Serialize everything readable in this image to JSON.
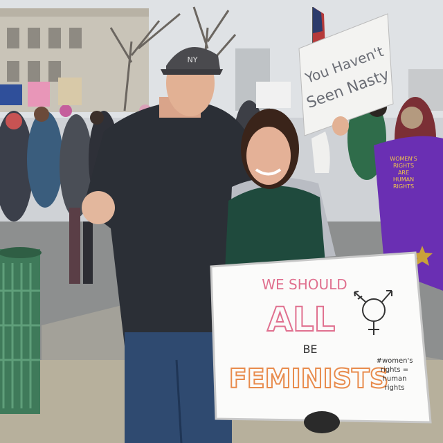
{
  "signs": {
    "top_right": {
      "line1": "You Haven't",
      "line2": "Seen Nasty"
    },
    "main": {
      "line1": "WE SHOULD",
      "line2": "ALL",
      "line3": "BE",
      "line4": "FEMINISTS",
      "hashtag_line1": "#women's",
      "hashtag_line2": "rights =",
      "hashtag_line3": "human",
      "hashtag_line4": "rights"
    },
    "purple_cape": {
      "line1": "WOMEN'S",
      "line2": "RIGHTS",
      "line3": "ARE",
      "line4": "HUMAN",
      "line5": "RIGHTS"
    }
  },
  "cap_logo": "NY",
  "colors": {
    "sky": "#dfe2e5",
    "street": "#8d8f8f",
    "sidewalk": "#b7b09c",
    "jacket_dark": "#2b2f36",
    "vest_green": "#1f4a3d",
    "hoodie_grey": "#b9bcc3",
    "cape_purple": "#6a2fb3",
    "trash_can": "#3f7a5a",
    "sign_pink": "#e0708f",
    "sign_orange": "#e88b4c"
  }
}
